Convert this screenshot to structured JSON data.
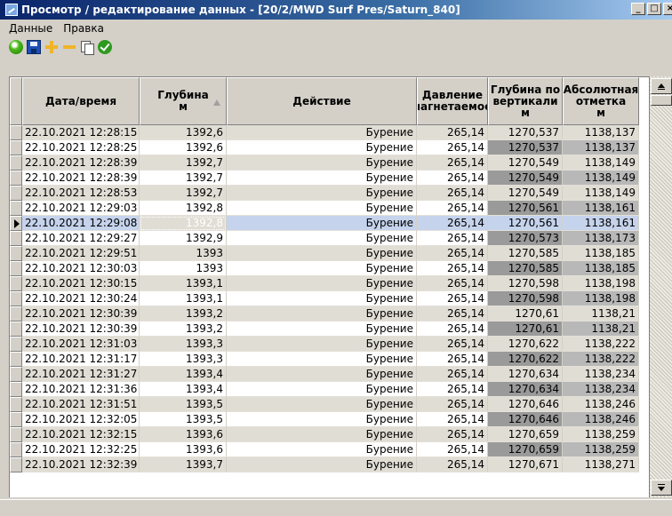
{
  "window": {
    "title": "Просмотр / редактирование данных - [20/2/MWD Surf Pres/Saturn_840]",
    "buttons": [
      "_",
      "□",
      "×"
    ]
  },
  "menu": [
    {
      "label": "Данные"
    },
    {
      "label": "Правка"
    }
  ],
  "toolbar": [
    {
      "name": "add-record-icon"
    },
    {
      "name": "save-icon"
    },
    {
      "name": "insert-row-icon"
    },
    {
      "name": "delete-row-icon"
    },
    {
      "name": "copy-icon"
    },
    {
      "name": "apply-icon"
    }
  ],
  "colors": {
    "title_start": "#0a246a",
    "selection": "#0a246a",
    "current_row": "#c5d3ec",
    "tvd_column": "#9a9a9a",
    "abs_column": "#b8b8b8"
  },
  "table": {
    "columns": [
      {
        "label": "Дата/время",
        "sorted": false
      },
      {
        "label": "Глубина\nм",
        "sorted": true
      },
      {
        "label": "Действие",
        "sorted": false
      },
      {
        "label": "Давление\nнагнетаемое",
        "sorted": false
      },
      {
        "label": "Глубина по\nвертикали\nм",
        "sorted": false
      },
      {
        "label": "Абсолютная\nотметка\nм",
        "sorted": false
      }
    ],
    "current_row": 6,
    "rows": [
      [
        "22.10.2021 12:28:15",
        "1392,6",
        "Бурение",
        "265,14",
        "1270,537",
        "1138,137"
      ],
      [
        "22.10.2021 12:28:25",
        "1392,6",
        "Бурение",
        "265,14",
        "1270,537",
        "1138,137"
      ],
      [
        "22.10.2021 12:28:39",
        "1392,7",
        "Бурение",
        "265,14",
        "1270,549",
        "1138,149"
      ],
      [
        "22.10.2021 12:28:39",
        "1392,7",
        "Бурение",
        "265,14",
        "1270,549",
        "1138,149"
      ],
      [
        "22.10.2021 12:28:53",
        "1392,7",
        "Бурение",
        "265,14",
        "1270,549",
        "1138,149"
      ],
      [
        "22.10.2021 12:29:03",
        "1392,8",
        "Бурение",
        "265,14",
        "1270,561",
        "1138,161"
      ],
      [
        "22.10.2021 12:29:08",
        "1392,8",
        "Бурение",
        "265,14",
        "1270,561",
        "1138,161"
      ],
      [
        "22.10.2021 12:29:27",
        "1392,9",
        "Бурение",
        "265,14",
        "1270,573",
        "1138,173"
      ],
      [
        "22.10.2021 12:29:51",
        "1393",
        "Бурение",
        "265,14",
        "1270,585",
        "1138,185"
      ],
      [
        "22.10.2021 12:30:03",
        "1393",
        "Бурение",
        "265,14",
        "1270,585",
        "1138,185"
      ],
      [
        "22.10.2021 12:30:15",
        "1393,1",
        "Бурение",
        "265,14",
        "1270,598",
        "1138,198"
      ],
      [
        "22.10.2021 12:30:24",
        "1393,1",
        "Бурение",
        "265,14",
        "1270,598",
        "1138,198"
      ],
      [
        "22.10.2021 12:30:39",
        "1393,2",
        "Бурение",
        "265,14",
        "1270,61",
        "1138,21"
      ],
      [
        "22.10.2021 12:30:39",
        "1393,2",
        "Бурение",
        "265,14",
        "1270,61",
        "1138,21"
      ],
      [
        "22.10.2021 12:31:03",
        "1393,3",
        "Бурение",
        "265,14",
        "1270,622",
        "1138,222"
      ],
      [
        "22.10.2021 12:31:17",
        "1393,3",
        "Бурение",
        "265,14",
        "1270,622",
        "1138,222"
      ],
      [
        "22.10.2021 12:31:27",
        "1393,4",
        "Бурение",
        "265,14",
        "1270,634",
        "1138,234"
      ],
      [
        "22.10.2021 12:31:36",
        "1393,4",
        "Бурение",
        "265,14",
        "1270,634",
        "1138,234"
      ],
      [
        "22.10.2021 12:31:51",
        "1393,5",
        "Бурение",
        "265,14",
        "1270,646",
        "1138,246"
      ],
      [
        "22.10.2021 12:32:05",
        "1393,5",
        "Бурение",
        "265,14",
        "1270,646",
        "1138,246"
      ],
      [
        "22.10.2021 12:32:15",
        "1393,6",
        "Бурение",
        "265,14",
        "1270,659",
        "1138,259"
      ],
      [
        "22.10.2021 12:32:25",
        "1393,6",
        "Бурение",
        "265,14",
        "1270,659",
        "1138,259"
      ],
      [
        "22.10.2021 12:32:39",
        "1393,7",
        "Бурение",
        "265,14",
        "1270,671",
        "1138,271"
      ]
    ]
  }
}
